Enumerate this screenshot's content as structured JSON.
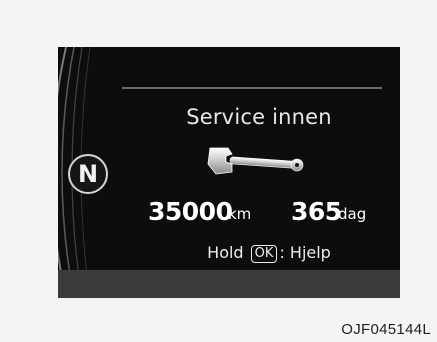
{
  "display": {
    "title": "Service innen",
    "distance_value": "35000",
    "distance_unit": "km",
    "days_value": "365",
    "days_unit": "dag",
    "hint_prefix": "Hold",
    "hint_key": "OK",
    "hint_suffix": ": Hjelp",
    "gear_indicator": "N",
    "icon": "wrench-icon"
  },
  "caption": "OJF045144L"
}
